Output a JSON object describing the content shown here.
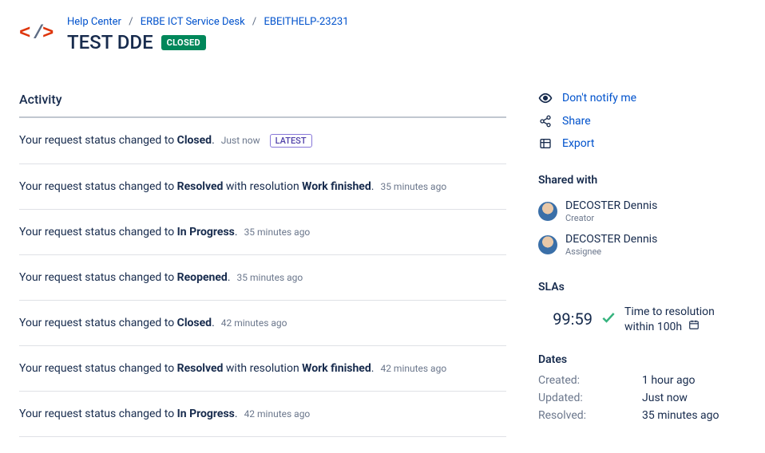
{
  "breadcrumbs": {
    "items": [
      "Help Center",
      "ERBE ICT Service Desk",
      "EBEITHELP-23231"
    ]
  },
  "title": "TEST DDE",
  "status_badge": "CLOSED",
  "activity": {
    "heading": "Activity",
    "items": [
      {
        "prefix": "Your request status changed to ",
        "status": "Closed",
        "suffix": ".",
        "timestamp": "Just now",
        "latest": "LATEST"
      },
      {
        "prefix": "Your request status changed to ",
        "status": "Resolved",
        "mid": " with resolution ",
        "status2": "Work finished",
        "suffix": ".",
        "timestamp": "35 minutes ago"
      },
      {
        "prefix": "Your request status changed to ",
        "status": "In Progress",
        "suffix": ".",
        "timestamp": "35 minutes ago"
      },
      {
        "prefix": "Your request status changed to ",
        "status": "Reopened",
        "suffix": ".",
        "timestamp": "35 minutes ago"
      },
      {
        "prefix": "Your request status changed to ",
        "status": "Closed",
        "suffix": ".",
        "timestamp": "42 minutes ago"
      },
      {
        "prefix": "Your request status changed to ",
        "status": "Resolved",
        "mid": " with resolution ",
        "status2": "Work finished",
        "suffix": ".",
        "timestamp": "42 minutes ago"
      },
      {
        "prefix": "Your request status changed to ",
        "status": "In Progress",
        "suffix": ".",
        "timestamp": "42 minutes ago"
      }
    ]
  },
  "actions": {
    "notify": "Don't notify me",
    "share": "Share",
    "export": "Export"
  },
  "shared_with": {
    "heading": "Shared with",
    "people": [
      {
        "name": "DECOSTER Dennis",
        "role": "Creator"
      },
      {
        "name": "DECOSTER Dennis",
        "role": "Assignee"
      }
    ]
  },
  "slas": {
    "heading": "SLAs",
    "time": "99:59",
    "line1": "Time to resolution",
    "line2": "within 100h"
  },
  "dates": {
    "heading": "Dates",
    "rows": [
      {
        "k": "Created:",
        "v": "1 hour ago"
      },
      {
        "k": "Updated:",
        "v": "Just now"
      },
      {
        "k": "Resolved:",
        "v": "35 minutes ago"
      }
    ]
  }
}
